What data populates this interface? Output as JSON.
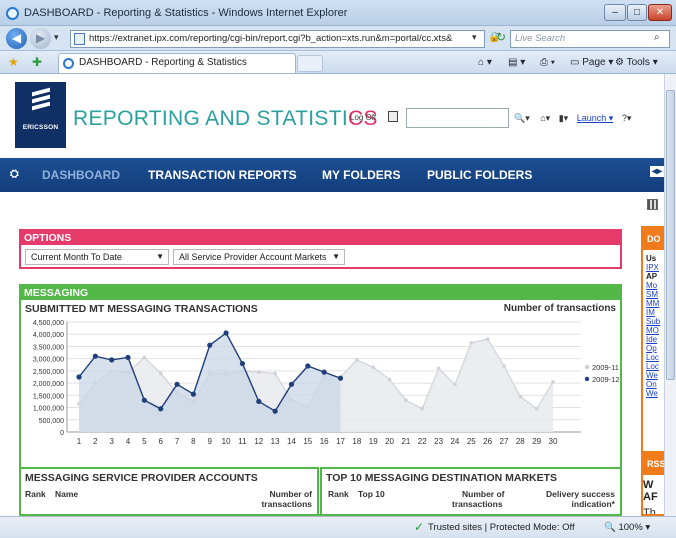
{
  "window": {
    "title": "DASHBOARD - Reporting & Statistics - Windows Internet Explorer"
  },
  "browser": {
    "url": "https://extranet.ipx.com/reporting/cgi-bin/report.cgi?b_action=xts.run&m=portal/cc.xts&",
    "search_placeholder": "Live Search",
    "tab_title": "DASHBOARD - Reporting & Statistics",
    "page_menu": "Page",
    "tools_menu": "Tools",
    "status": "Trusted sites | Protected Mode: Off",
    "zoom": "100%"
  },
  "header": {
    "brand": "ERICSSON",
    "title_a": "REPORTING AND STATISTI",
    "title_b": "CS",
    "logoff": "Log Off",
    "launch": "Launch"
  },
  "nav": {
    "items": [
      "DASHBOARD",
      "TRANSACTION REPORTS",
      "MY FOLDERS",
      "PUBLIC FOLDERS"
    ]
  },
  "options": {
    "header": "OPTIONS",
    "period": "Current Month To Date",
    "markets": "All Service Provider Account Markets"
  },
  "messaging": {
    "header": "MESSAGING",
    "chart_title": "SUBMITTED MT MESSAGING TRANSACTIONS",
    "chart_ylabel": "Number of transactions"
  },
  "chart_data": {
    "type": "area",
    "title": "SUBMITTED MT MESSAGING TRANSACTIONS",
    "ylabel": "Number of transactions",
    "xlabel": "",
    "ylim": [
      0,
      4500000
    ],
    "yticks": [
      "4,500,000",
      "4,000,000",
      "3,500,000",
      "3,000,000",
      "2,500,000",
      "2,000,000",
      "1,500,000",
      "1,000,000",
      "500,000",
      "0"
    ],
    "x": [
      1,
      2,
      3,
      4,
      5,
      6,
      7,
      8,
      9,
      10,
      11,
      12,
      13,
      14,
      15,
      16,
      17,
      18,
      19,
      20,
      21,
      22,
      23,
      24,
      25,
      26,
      27,
      28,
      29,
      30
    ],
    "legend_position": "right",
    "series": [
      {
        "name": "2009-11",
        "color": "#c9ced6",
        "values": [
          1150000,
          2000000,
          2500000,
          2450000,
          3050000,
          2400000,
          1600000,
          1250000,
          2400000,
          2400000,
          2500000,
          2450000,
          2400000,
          1300000,
          1050000,
          2300000,
          2250000,
          2950000,
          2650000,
          2150000,
          1300000,
          950000,
          2600000,
          1950000,
          3650000,
          3800000,
          2700000,
          1450000,
          950000,
          2050000
        ]
      },
      {
        "name": "2009-12",
        "color": "#1e3f7a",
        "values": [
          2250000,
          3100000,
          2950000,
          3050000,
          1300000,
          950000,
          1950000,
          1550000,
          3550000,
          4050000,
          2800000,
          1250000,
          850000,
          1950000,
          2700000,
          2450000,
          2200000
        ]
      }
    ]
  },
  "accounts": {
    "title": "MESSAGING SERVICE PROVIDER ACCOUNTS",
    "col_rank": "Rank",
    "col_name": "Name",
    "col_num_1": "Number of",
    "col_num_2": "transactions"
  },
  "destinations": {
    "title": "TOP 10 MESSAGING DESTINATION MARKETS",
    "col_rank": "Rank",
    "col_top": "Top 10",
    "col_num_1": "Number of",
    "col_num_2": "transactions",
    "col_del_1": "Delivery success",
    "col_del_2": "indication*"
  },
  "side": {
    "header": "DO",
    "line1": "Us",
    "line2": "IPX",
    "line3": "AP",
    "links": [
      "Mo",
      "SM",
      "MM",
      "IM",
      "Sub",
      "MO",
      "Ide",
      "Op",
      "Loc",
      "Loc",
      "We",
      "On",
      "We"
    ],
    "rss": "RSS",
    "rss_line1": "W",
    "rss_line2": "AF",
    "rss_line3": "Th"
  }
}
